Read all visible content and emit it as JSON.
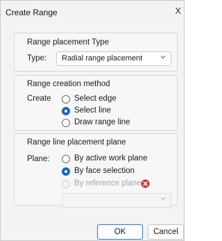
{
  "dialog": {
    "title": "Create Range",
    "close_glyph": "X"
  },
  "placement_type": {
    "group_title": "Range placement Type",
    "type_label": "Type:",
    "selected_value": "Radial range placement"
  },
  "creation_method": {
    "group_title": "Range creation method",
    "create_label": "Create",
    "options": [
      {
        "label": "Select edge",
        "checked": false,
        "disabled": false
      },
      {
        "label": "Select line",
        "checked": true,
        "disabled": false
      },
      {
        "label": "Draw range line",
        "checked": false,
        "disabled": false
      }
    ]
  },
  "placement_plane": {
    "group_title": "Range line placement plane",
    "plane_label": "Plane:",
    "options": [
      {
        "label": "By active work plane",
        "checked": false,
        "disabled": false
      },
      {
        "label": "By face selection",
        "checked": true,
        "disabled": false
      },
      {
        "label": "By reference plane",
        "checked": false,
        "disabled": true
      }
    ],
    "plane_dropdown_value": ""
  },
  "buttons": {
    "ok": "OK",
    "cancel": "Cancel"
  },
  "colors": {
    "accent": "#1a67c2",
    "error": "#d62b2b"
  },
  "icons": {
    "close": "close-icon",
    "chevron": "chevron-down-icon",
    "error": "error-icon"
  }
}
